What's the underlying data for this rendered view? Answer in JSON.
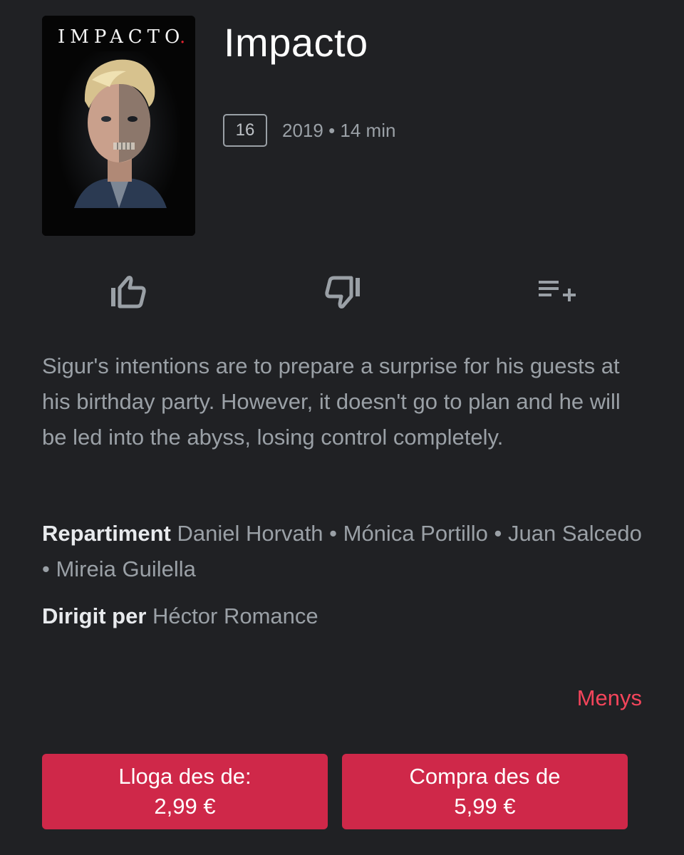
{
  "movie": {
    "poster_text": "IMPACTO",
    "poster_dot": ".",
    "title": "Impacto",
    "age_rating": "16",
    "year_duration": "2019 • 14 min"
  },
  "actions": [
    {
      "name": "like",
      "icon": "thumb-up-outline-icon"
    },
    {
      "name": "dislike",
      "icon": "thumb-down-outline-icon"
    },
    {
      "name": "wishlist",
      "icon": "playlist-add-icon"
    }
  ],
  "description": "Sigur's intentions are to prepare a surprise for his guests at his birthday party. However, it doesn't go to plan and he will be led into the abyss, losing control completely.",
  "credits": {
    "cast_label": "Repartiment",
    "cast_value": "Daniel Horvath • Mónica Portillo • Juan Salcedo • Mireia Guilella",
    "director_label": "Dirigit per",
    "director_value": "Héctor Romance"
  },
  "less_label": "Menys",
  "buttons": {
    "rent_line1": "Lloga des de:",
    "rent_line2": "2,99 €",
    "buy_line1": "Compra des de",
    "buy_line2": "5,99 €"
  },
  "colors": {
    "background": "#202124",
    "accent": "#cf2849",
    "link": "#f4455b",
    "secondary_text": "#9aa0a6"
  }
}
